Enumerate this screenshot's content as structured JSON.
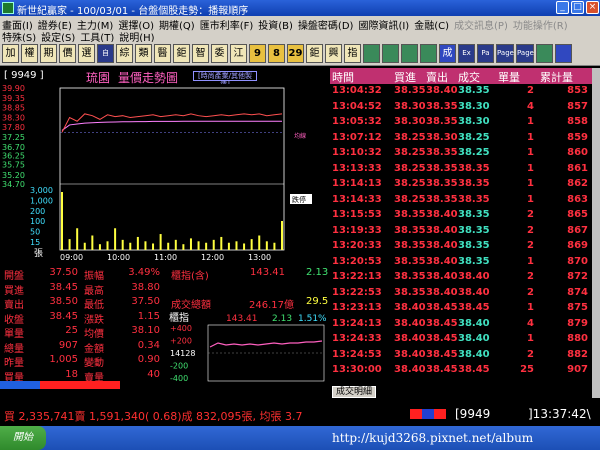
{
  "window": {
    "title": "新世紀贏家 - 100/03/01 - 台盤個股走勢：播報順序"
  },
  "menu": {
    "row1": [
      "畫面(I)",
      "證券(E)",
      "主力(M)",
      "選擇(O)",
      "期權(Q)",
      "匯市利率(F)",
      "投資(B)",
      "操盤密碼(D)",
      "國際資訊(I)",
      "金融(C)",
      "成交訊息(P)",
      "功能操作(R)"
    ],
    "row2": [
      "特殊(S)",
      "設定(S)",
      "工具(T)",
      "說明(H)"
    ],
    "row1_disabled": [
      10,
      11
    ]
  },
  "toolbar": {
    "buttons": [
      "加",
      "權",
      "期",
      "價",
      "選",
      "自",
      "綜",
      "類",
      "醫",
      "鉅",
      "智",
      "委",
      "江",
      "9",
      "8",
      "29",
      "鉅",
      "興",
      "指",
      "",
      "",
      "",
      "",
      "成",
      "Ex",
      "Pa",
      "Page",
      "Page",
      "",
      ""
    ]
  },
  "header": {
    "code": "[ 9949 ]",
    "stock_name": "琉園",
    "chart_title": "量價走勢圖",
    "industry": "[時尚產業/其他製造]"
  },
  "chart": {
    "price_ticks": [
      "39.90",
      "39.35",
      "38.85",
      "38.30",
      "37.80",
      "37.25",
      "36.70",
      "36.25",
      "35.75",
      "35.20",
      "34.70"
    ],
    "volume_ticks": [
      "3,000",
      "1,000",
      "200",
      "100",
      "50",
      "15"
    ],
    "volume_unit": "張",
    "time_ticks": [
      "09:00",
      "10:00",
      "11:00",
      "12:00",
      "13:00"
    ],
    "label_pink": "均線",
    "label_limit": "跌停",
    "ref_price": 37.5,
    "series_price": [
      37.5,
      38.3,
      38.1,
      38.5,
      38.4,
      38.2,
      38.45,
      38.35,
      38.4,
      38.3,
      38.35,
      38.4,
      38.45,
      38.35,
      38.4,
      38.45,
      38.4,
      38.5,
      38.4,
      38.35,
      38.4,
      38.45,
      38.4,
      38.45,
      38.5,
      38.45,
      38.5,
      38.4,
      38.45,
      38.5
    ],
    "series_avg": [
      37.6,
      37.9,
      37.95,
      38.0,
      38.02,
      38.04,
      38.05,
      38.06,
      38.07,
      38.07,
      38.08,
      38.08,
      38.09,
      38.09,
      38.09,
      38.09,
      38.1,
      38.1,
      38.1,
      38.1,
      38.1,
      38.1,
      38.1,
      38.1,
      38.1,
      38.1,
      38.1,
      38.1,
      38.1,
      38.1
    ],
    "series_volume": [
      80,
      15,
      30,
      10,
      20,
      8,
      12,
      30,
      14,
      10,
      18,
      12,
      9,
      22,
      10,
      14,
      8,
      16,
      12,
      10,
      14,
      18,
      10,
      12,
      9,
      15,
      20,
      12,
      10,
      40
    ]
  },
  "quote": {
    "rows": [
      {
        "l1": "開盤",
        "v1": "37.50",
        "l2": "振幅",
        "v2": "3.49%"
      },
      {
        "l1": "買進",
        "v1": "38.45",
        "l2": "最高",
        "v2": "38.80"
      },
      {
        "l1": "賣出",
        "v1": "38.50",
        "l2": "最低",
        "v2": "37.50"
      },
      {
        "l1": "收盤",
        "v1": "38.45",
        "l2": "漲跌",
        "v2": "1.15"
      },
      {
        "l1": "單量",
        "v1": "25",
        "l2": "均價",
        "v2": "38.10"
      },
      {
        "l1": "總量",
        "v1": "907",
        "l2": "金額",
        "v2": "0.34"
      },
      {
        "l1": "昨量",
        "v1": "1,005",
        "l2": "變動",
        "v2": "0.90"
      },
      {
        "l1": "買量",
        "v1": "18",
        "l2": "賣量",
        "v2": "40"
      }
    ],
    "index_label": "櫃指(含)",
    "index_value": "143.41",
    "index_change": "2.13",
    "turnover_label": "成交總額",
    "turnover_value": "246.17億",
    "turnover_change": "29.5",
    "mini": {
      "title": "櫃指",
      "value": "143.41",
      "change": "2.13",
      "pct": "1.51%",
      "ticks": [
        "+400",
        "+200",
        "14128",
        "-200",
        "-400"
      ]
    }
  },
  "ticks": {
    "headers": [
      "時間",
      "買進",
      "賣出",
      "成交",
      "單量",
      "累計量"
    ],
    "rows": [
      [
        "13:04:32",
        "38.35",
        "38.40",
        "38.35",
        "2",
        "853"
      ],
      [
        "13:04:52",
        "38.30",
        "38.35",
        "38.30",
        "4",
        "857"
      ],
      [
        "13:05:32",
        "38.30",
        "38.35",
        "38.30",
        "1",
        "858"
      ],
      [
        "13:07:12",
        "38.25",
        "38.30",
        "38.25",
        "1",
        "859"
      ],
      [
        "13:10:32",
        "38.25",
        "38.35",
        "38.25",
        "1",
        "860"
      ],
      [
        "13:13:33",
        "38.25",
        "38.35",
        "38.35",
        "1",
        "861"
      ],
      [
        "13:14:13",
        "38.25",
        "38.35",
        "38.35",
        "1",
        "862"
      ],
      [
        "13:14:33",
        "38.25",
        "38.35",
        "38.35",
        "1",
        "863"
      ],
      [
        "13:15:53",
        "38.35",
        "38.40",
        "38.35",
        "2",
        "865"
      ],
      [
        "13:19:33",
        "38.35",
        "38.40",
        "38.35",
        "2",
        "867"
      ],
      [
        "13:20:33",
        "38.35",
        "38.40",
        "38.35",
        "2",
        "869"
      ],
      [
        "13:20:53",
        "38.35",
        "38.40",
        "38.35",
        "1",
        "870"
      ],
      [
        "13:22:13",
        "38.35",
        "38.40",
        "38.40",
        "2",
        "872"
      ],
      [
        "13:22:53",
        "38.35",
        "38.40",
        "38.40",
        "2",
        "874"
      ],
      [
        "13:23:13",
        "38.40",
        "38.45",
        "38.45",
        "1",
        "875"
      ],
      [
        "13:24:13",
        "38.40",
        "38.45",
        "38.40",
        "4",
        "879"
      ],
      [
        "13:24:33",
        "38.40",
        "38.45",
        "38.40",
        "1",
        "880"
      ],
      [
        "13:24:53",
        "38.40",
        "38.45",
        "38.40",
        "2",
        "882"
      ],
      [
        "13:30:00",
        "38.40",
        "38.45",
        "38.45",
        "25",
        "907"
      ]
    ],
    "tab_label": "成交明細"
  },
  "status": {
    "text": "買 2,335,741賣 1,591,340( 0.68)成 832,095張, 均張 3.7",
    "code": "[9949",
    "time": "]13:37:42\\"
  },
  "taskbar": {
    "start_label": "開始",
    "watermark": "http://kujd3268.pixnet.net/album"
  },
  "colors": {
    "red": "#ff3040",
    "green": "#40e070",
    "pink": "#ff40a0",
    "price_line": "#ff5050",
    "avg_line": "#ff80ff",
    "volume": "#ffff40"
  }
}
